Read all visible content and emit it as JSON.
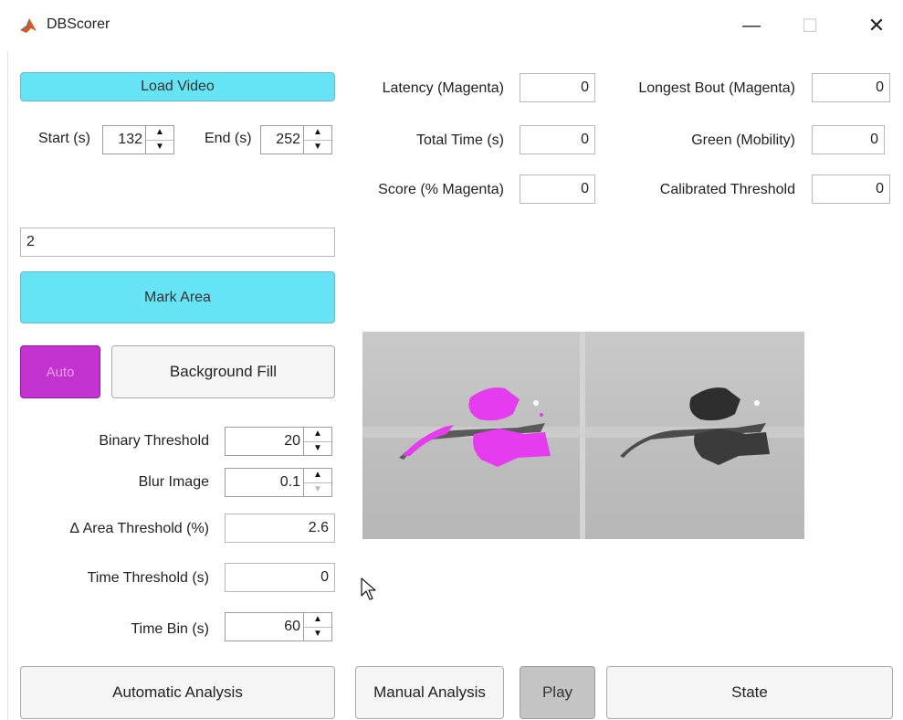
{
  "window": {
    "title": "DBScorer",
    "minimize_glyph": "—",
    "maximize_glyph": "☐",
    "close_glyph": "✕"
  },
  "controls": {
    "load_video": "Load Video",
    "start_label": "Start (s)",
    "start_value": "132",
    "end_label": "End (s)",
    "end_value": "252",
    "text_field_value": "2",
    "mark_area": "Mark Area",
    "auto": "Auto",
    "background_fill": "Background Fill",
    "binary_threshold_label": "Binary Threshold",
    "binary_threshold_value": "20",
    "blur_image_label": "Blur Image",
    "blur_image_value": "0.1",
    "area_threshold_label": "Δ Area Threshold (%)",
    "area_threshold_value": "2.6",
    "time_threshold_label": "Time Threshold (s)",
    "time_threshold_value": "0",
    "time_bin_label": "Time Bin (s)",
    "time_bin_value": "60"
  },
  "results": {
    "latency_label": "Latency (Magenta)",
    "latency_value": "0",
    "longest_bout_label": "Longest Bout (Magenta)",
    "longest_bout_value": "0",
    "total_time_label": "Total Time (s)",
    "total_time_value": "0",
    "green_label": "Green (Mobility)",
    "green_value": "0",
    "score_label": "Score (% Magenta)",
    "score_value": "0",
    "calibrated_label": "Calibrated Threshold",
    "calibrated_value": "0"
  },
  "bottom": {
    "automatic_analysis": "Automatic Analysis",
    "manual_analysis": "Manual Analysis",
    "play": "Play",
    "state": "State"
  },
  "colors": {
    "cyan_button": "#66e3f5",
    "auto_button": "#c333cf",
    "magenta_overlay": "#e63cf0",
    "play_button": "#c4c4c4"
  },
  "icons": {
    "app": "matlab-icon",
    "spinner_up": "triangle-up",
    "spinner_down": "triangle-down",
    "cursor": "mouse-pointer"
  }
}
